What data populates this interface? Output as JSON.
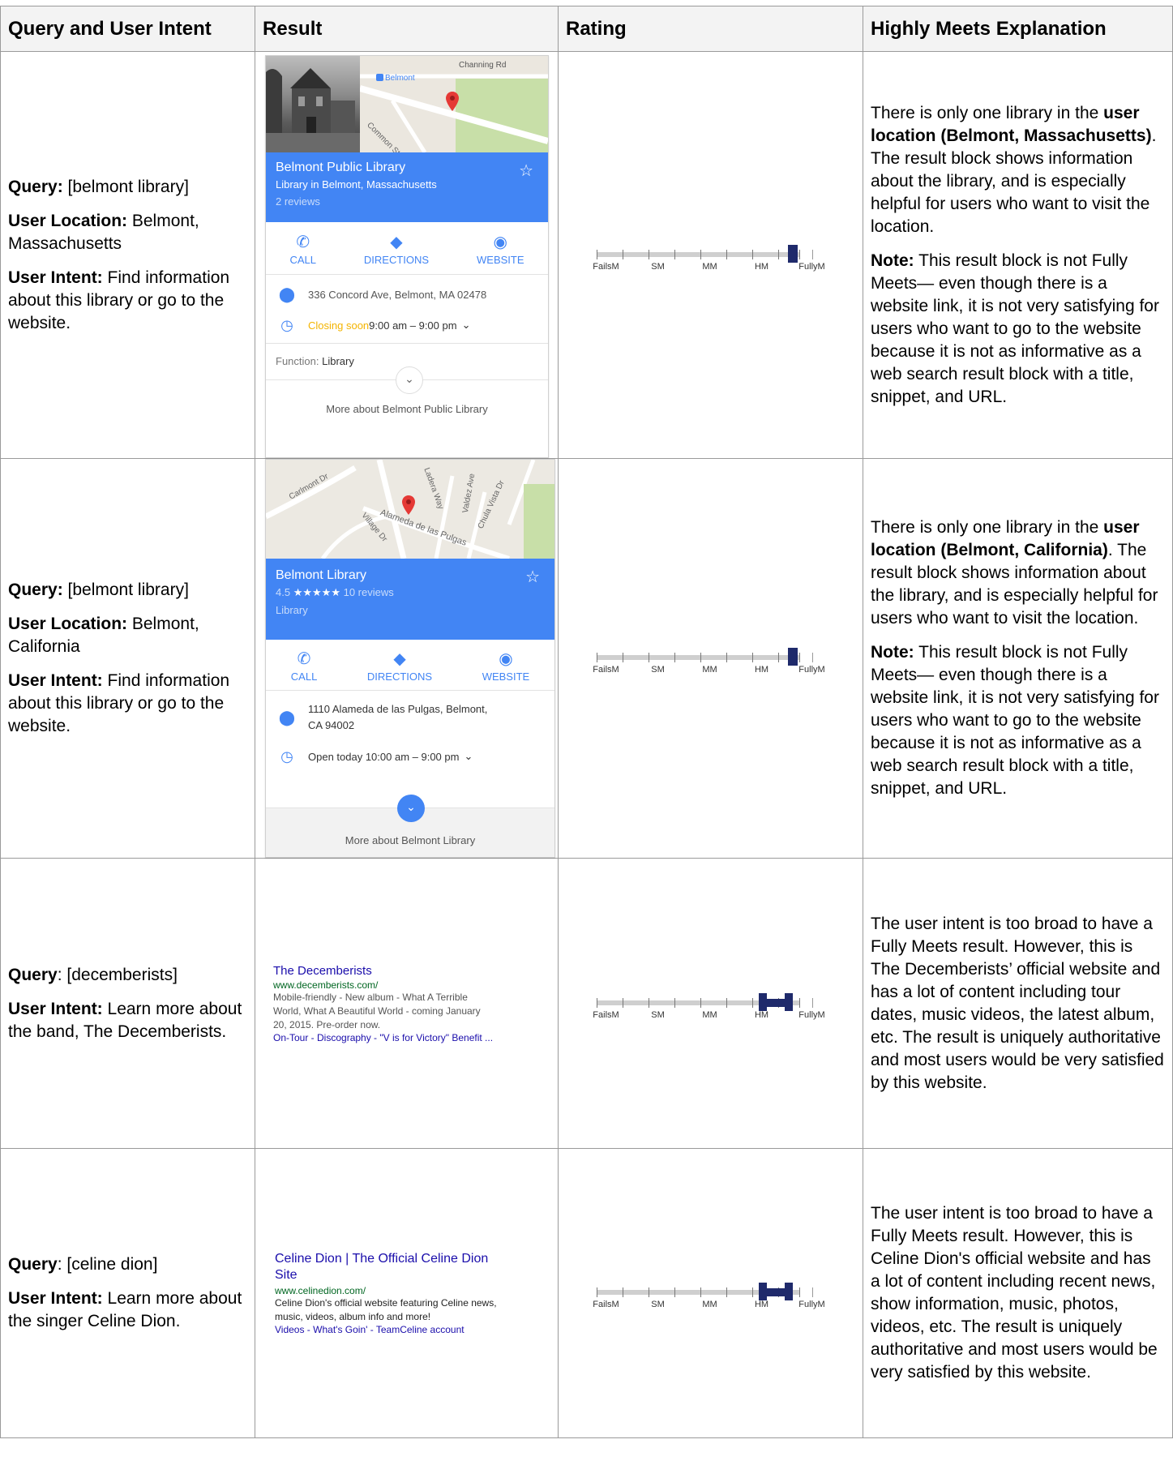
{
  "headers": [
    "Query and User Intent",
    "Result",
    "Rating",
    "Highly Meets Explanation"
  ],
  "labels": {
    "query": "Query:",
    "query_colon_plain": "Query",
    "user_location": "User Location:",
    "user_intent": "User Intent:",
    "note": "Note:"
  },
  "rows": [
    {
      "query": " [belmont library]",
      "location": " Belmont, Massachusetts",
      "intent": "  Find information about this library or go to the website.",
      "card": {
        "map_label_road": "Channing Rd",
        "map_label_place": "Belmont",
        "map_label_street": "Common St",
        "title": "Belmont Public Library",
        "subtitle": "Library in Belmont, Massachusetts",
        "reviews": "2 reviews",
        "call": "CALL",
        "directions": "DIRECTIONS",
        "website": "WEBSITE",
        "address": "336 Concord Ave, Belmont, MA 02478",
        "hours_status": "Closing soon",
        "hours": " 9:00 am – 9:00 pm",
        "function_label": "Function:",
        "function_value": " Library",
        "more": "More about Belmont Public Library"
      },
      "rating": {
        "scale_labels": [
          "FailsM",
          "SM",
          "MM",
          "HM",
          "FullyM"
        ],
        "value": "HM+"
      },
      "expl_1a": "There is only one library in the ",
      "expl_1b": "user location (Belmont, Massachusetts)",
      "expl_1c": ".  The result block shows information about the library, and is especially helpful for users who want to visit the location.",
      "expl_2": " This result block is not Fully Meets— even though there is a website link, it is not very satisfying for users who want to go to the website because it is not as informative as a web search result block with a title, snippet, and URL."
    },
    {
      "query": " [belmont library]",
      "location": " Belmont, California",
      "intent": "  Find information about this library or go to the website.",
      "card": {
        "map_label_1": "Carlmont Dr",
        "map_label_2": "Ladera Way",
        "map_label_3": "Valdez Ave",
        "map_label_4": "Chula Vista Dr",
        "map_label_5": "Alameda de las Pulgas",
        "map_label_6": "Village Dr",
        "title": "Belmont Library",
        "rating_num": "4.5",
        "stars": "★★★★★",
        "reviews": "10 reviews",
        "category": "Library",
        "call": "CALL",
        "directions": "DIRECTIONS",
        "website": "WEBSITE",
        "address_1": "1110 Alameda de las Pulgas, Belmont,",
        "address_2": "CA 94002",
        "hours": "Open today 10:00 am – 9:00 pm",
        "more": "More about Belmont Library"
      },
      "rating": {
        "scale_labels": [
          "FailsM",
          "SM",
          "MM",
          "HM",
          "FullyM"
        ],
        "value": "HM+"
      },
      "expl_1a": "There is only one library in the ",
      "expl_1b": "user location (Belmont, California)",
      "expl_1c": ".  The result block shows information about the library, and is especially helpful for users who want to visit the location.",
      "expl_2": " This result block is not Fully Meets— even though there is a website link, it is not very satisfying for users who want to go to the website because it is not as informative as a web search result block with a title, snippet, and URL."
    },
    {
      "query": ": [decemberists]",
      "intent": " Learn more about the band, The Decemberists.",
      "web": {
        "title": "The Decemberists",
        "url": "www.decemberists.com/",
        "desc_1": "Mobile-friendly - New album - What A Terrible",
        "desc_2": "World, What A Beautiful World - coming January",
        "desc_3": "20, 2015. Pre-order now.",
        "links": "On-Tour - Discography - \"V is for Victory\" Benefit ..."
      },
      "rating": {
        "scale_labels": [
          "FailsM",
          "SM",
          "MM",
          "HM",
          "FullyM"
        ],
        "value": "HM to HM+"
      },
      "expl": "The user intent is too broad to have a Fully Meets result. However, this is The Decemberists’ official website and has a lot of content including tour dates, music videos, the latest album, etc.  The result is uniquely authoritative and most users would be very satisfied by this website."
    },
    {
      "query": ": [celine dion]",
      "intent": " Learn more about the singer Celine Dion.",
      "web": {
        "title_1": "Celine Dion | The Official Celine Dion",
        "title_2": "Site",
        "url": "www.celinedion.com/",
        "desc_1": "Celine Dion's official website featuring Celine news,",
        "desc_2": "music, videos, album info and more!",
        "links": "Videos - What's Goin' - TeamCeline account"
      },
      "rating": {
        "scale_labels": [
          "FailsM",
          "SM",
          "MM",
          "HM",
          "FullyM"
        ],
        "value": "HM to HM+"
      },
      "expl": "The user intent is too broad to have a Fully Meets result. However, this is Celine Dion's official website and has a lot of content including recent news, show information, music, photos, videos, etc. The result is uniquely authoritative and most users would be very satisfied by this website."
    }
  ],
  "colors": {
    "accent_blue": "#4285f4",
    "rating_marker": "#1f2a6b",
    "link": "#1a0dab",
    "url_green": "#006621",
    "closing_soon": "#f4b400"
  }
}
